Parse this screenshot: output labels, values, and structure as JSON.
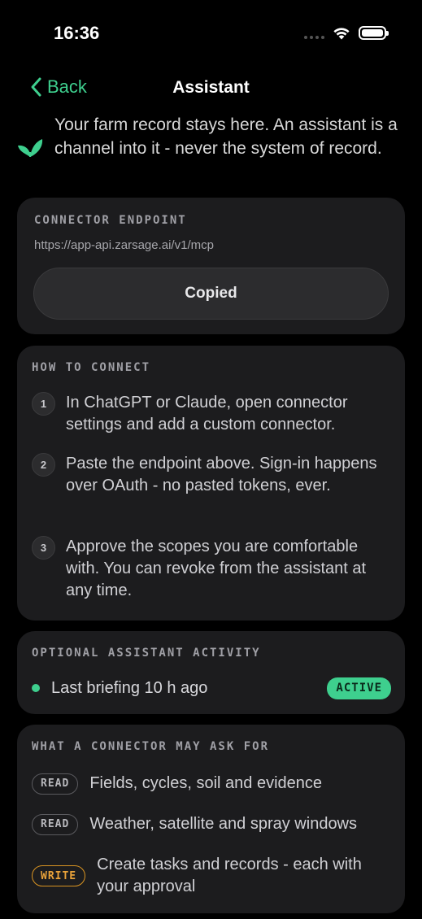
{
  "status_bar": {
    "time": "16:36"
  },
  "nav": {
    "back_label": "Back",
    "title": "Assistant"
  },
  "intro": {
    "text": "Your farm record stays here. An assistant is a channel into it - never the system of record."
  },
  "endpoint": {
    "label": "CONNECTOR ENDPOINT",
    "url": "https://app-api.zarsage.ai/v1/mcp",
    "button_label": "Copied"
  },
  "connect": {
    "label": "HOW TO CONNECT",
    "steps": [
      {
        "num": "1",
        "text": "In ChatGPT or Claude, open connector settings and add a custom connector."
      },
      {
        "num": "2",
        "text": "Paste the endpoint above. Sign-in happens over OAuth - no pasted tokens, ever."
      },
      {
        "num": "3",
        "text": "Approve the scopes you are comfortable with. You can revoke from the assistant at any time."
      }
    ]
  },
  "activity": {
    "label": "OPTIONAL ASSISTANT ACTIVITY",
    "text": "Last briefing 10 h ago",
    "badge": "ACTIVE"
  },
  "scopes": {
    "label": "WHAT A CONNECTOR MAY ASK FOR",
    "items": [
      {
        "badge": "READ",
        "text": "Fields, cycles, soil and evidence"
      },
      {
        "badge": "READ",
        "text": "Weather, satellite and spray windows"
      },
      {
        "badge": "WRITE",
        "text": "Create tasks and records - each with your approval"
      }
    ]
  },
  "colors": {
    "accent": "#3ecf8e",
    "write": "#e8a23a",
    "card": "#1c1c1e",
    "background": "#000000"
  },
  "icons": {
    "back": "chevron-left-icon",
    "brand": "leaf-icon",
    "wifi": "wifi-icon",
    "battery": "battery-icon",
    "signal": "signal-icon"
  }
}
